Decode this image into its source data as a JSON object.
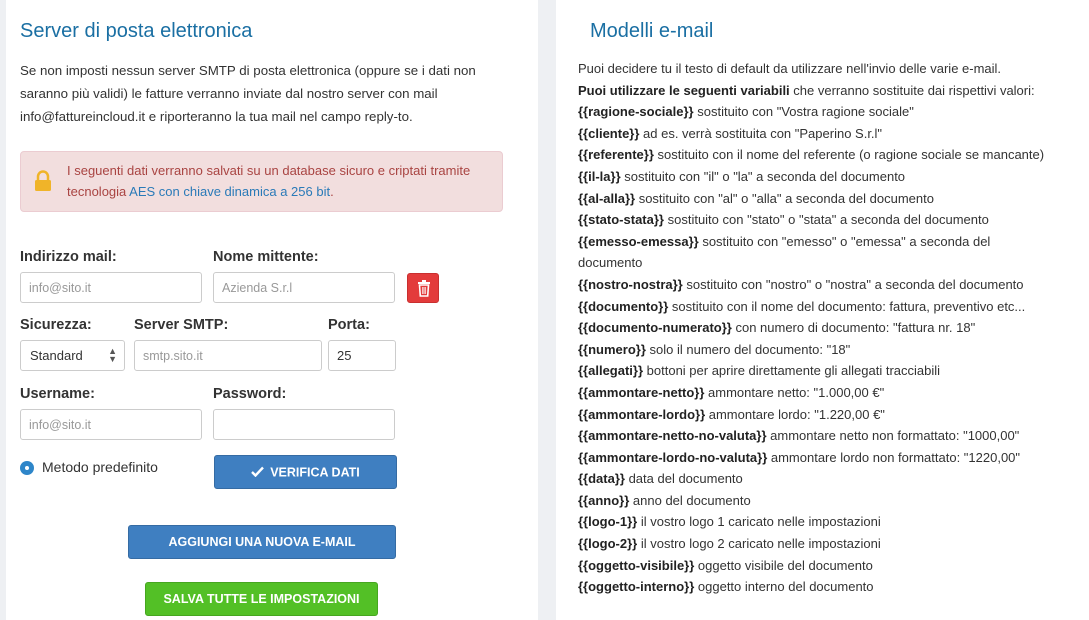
{
  "left": {
    "title": "Server di posta elettronica",
    "intro": "Se non imposti nessun server SMTP di posta elettronica (oppure se i dati non saranno più validi) le fatture verranno inviate dal nostro server con mail info@fattureincloud.it e riporteranno la tua mail nel campo reply-to.",
    "alert": {
      "text": "I seguenti dati verranno salvati su un database sicuro e criptati tramite tecnologia ",
      "link": "AES con chiave dinamica a 256 bit",
      "end": "."
    },
    "form": {
      "email_label": "Indirizzo mail:",
      "email_placeholder": "info@sito.it",
      "sender_label": "Nome mittente:",
      "sender_placeholder": "Azienda S.r.l",
      "security_label": "Sicurezza:",
      "security_value": "Standard",
      "smtp_label": "Server SMTP:",
      "smtp_placeholder": "smtp.sito.it",
      "port_label": "Porta:",
      "port_value": "25",
      "username_label": "Username:",
      "username_placeholder": "info@sito.it",
      "password_label": "Password:",
      "password_value": "",
      "default_method_label": "Metodo predefinito",
      "verify_button": "VERIFICA DATI"
    },
    "add_email_button": "AGGIUNGI UNA NUOVA E-MAIL",
    "save_all_button": "SALVA TUTTE LE IMPOSTAZIONI"
  },
  "right": {
    "title": "Modelli e-mail",
    "lines": [
      {
        "b": "",
        "t": "Puoi decidere tu il testo di default da utilizzare nell'invio delle varie e-mail."
      },
      {
        "b": "Puoi utilizzare le seguenti variabili",
        "t": " che verranno sostituite dai rispettivi valori:"
      },
      {
        "b": "{{ragione-sociale}}",
        "t": " sostituito con \"Vostra ragione sociale\""
      },
      {
        "b": "{{cliente}}",
        "t": " ad es. verrà sostituita con \"Paperino S.r.l\""
      },
      {
        "b": "{{referente}}",
        "t": " sostituito con il nome del referente (o ragione sociale se mancante)"
      },
      {
        "b": "{{il-la}}",
        "t": " sostituito con \"il\" o \"la\" a seconda del documento"
      },
      {
        "b": "{{al-alla}}",
        "t": " sostituito con \"al\" o \"alla\" a seconda del documento"
      },
      {
        "b": "{{stato-stata}}",
        "t": " sostituito con \"stato\" o \"stata\" a seconda del documento"
      },
      {
        "b": "{{emesso-emessa}}",
        "t": " sostituito con \"emesso\" o \"emessa\" a seconda del"
      },
      {
        "b": "",
        "t": "documento"
      },
      {
        "b": "{{nostro-nostra}}",
        "t": " sostituito con \"nostro\" o \"nostra\" a seconda del documento"
      },
      {
        "b": "{{documento}}",
        "t": " sostituito con il nome del documento: fattura, preventivo etc..."
      },
      {
        "b": "{{documento-numerato}}",
        "t": " con numero di documento: \"fattura nr. 18\""
      },
      {
        "b": "{{numero}}",
        "t": " solo il numero del documento: \"18\""
      },
      {
        "b": "{{allegati}}",
        "t": " bottoni per aprire direttamente gli allegati tracciabili"
      },
      {
        "b": "{{ammontare-netto}}",
        "t": " ammontare netto: \"1.000,00 €\""
      },
      {
        "b": "{{ammontare-lordo}}",
        "t": " ammontare lordo: \"1.220,00 €\""
      },
      {
        "b": "{{ammontare-netto-no-valuta}}",
        "t": " ammontare netto non formattato: \"1000,00\""
      },
      {
        "b": "{{ammontare-lordo-no-valuta}}",
        "t": " ammontare lordo non formattato: \"1220,00\""
      },
      {
        "b": "{{data}}",
        "t": " data del documento"
      },
      {
        "b": "{{anno}}",
        "t": " anno del documento"
      },
      {
        "b": "{{logo-1}}",
        "t": " il vostro logo 1 caricato nelle impostazioni"
      },
      {
        "b": "{{logo-2}}",
        "t": " il vostro logo 2 caricato nelle impostazioni"
      },
      {
        "b": "{{oggetto-visibile}}",
        "t": " oggetto visibile del documento"
      },
      {
        "b": "{{oggetto-interno}}",
        "t": " oggetto interno del documento"
      }
    ]
  }
}
